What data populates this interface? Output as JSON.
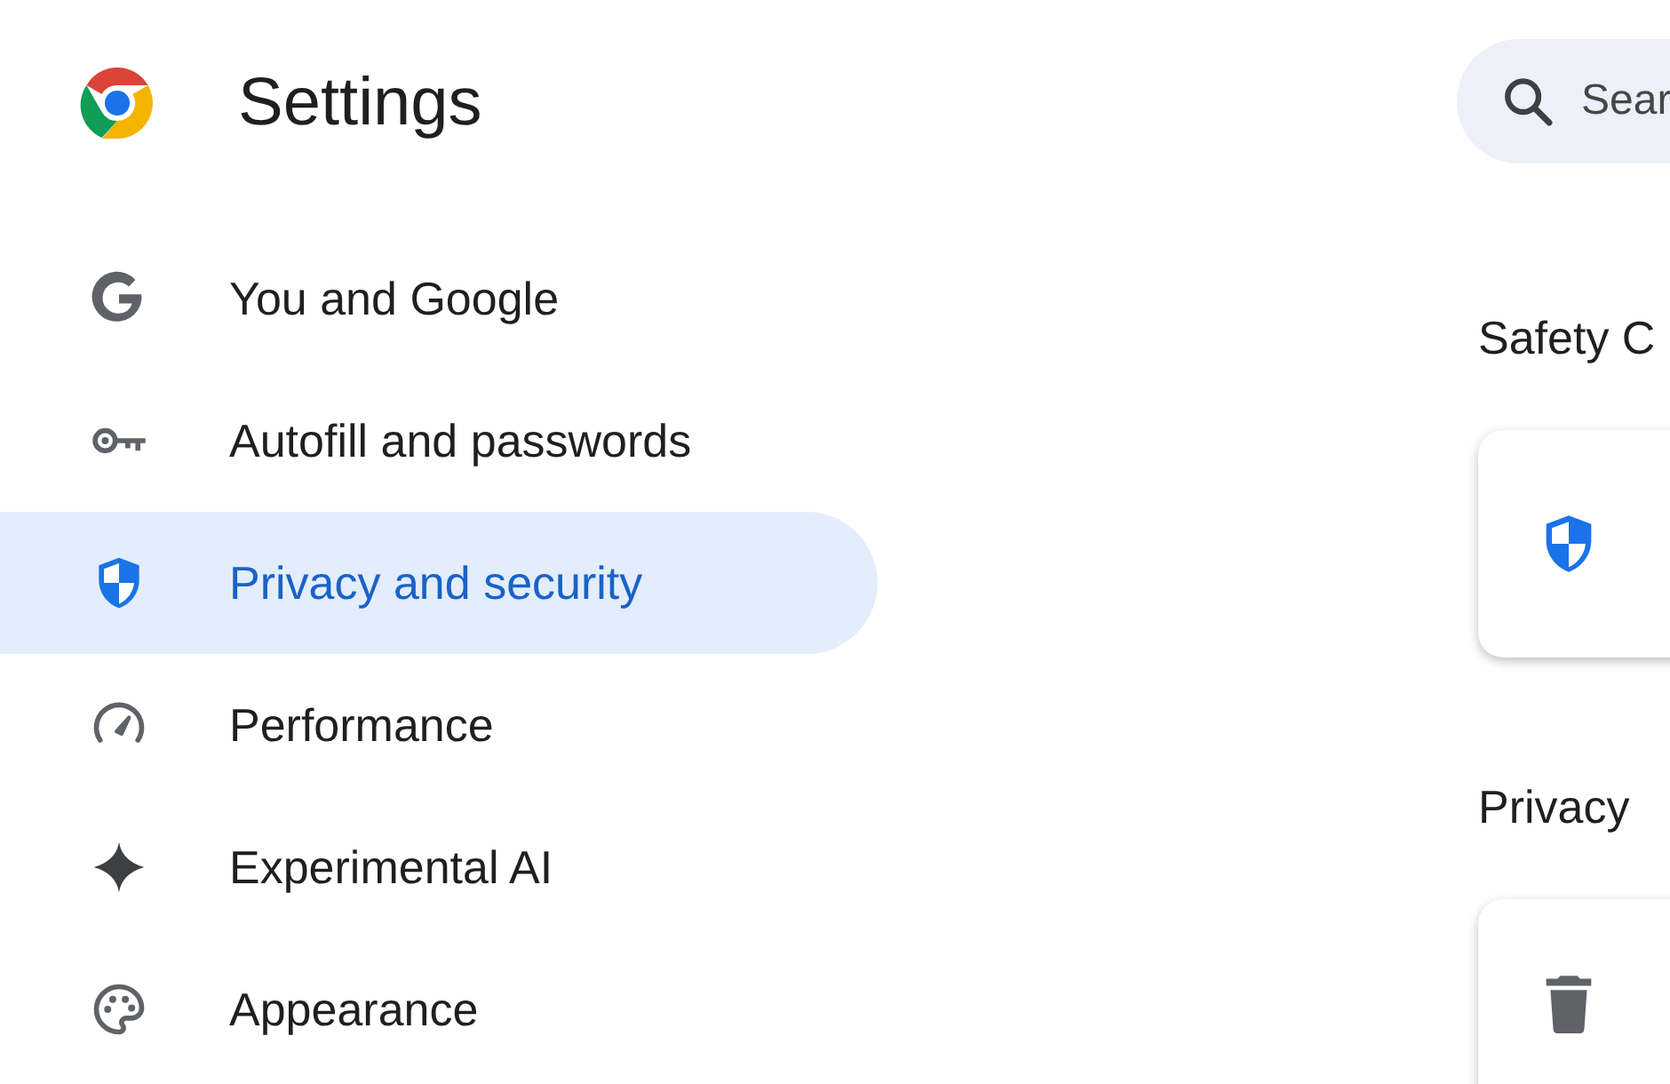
{
  "header": {
    "title": "Settings"
  },
  "search": {
    "placeholder": "Sear"
  },
  "sidebar": {
    "items": [
      {
        "label": "You and Google",
        "selected": false
      },
      {
        "label": "Autofill and passwords",
        "selected": false
      },
      {
        "label": "Privacy and security",
        "selected": true
      },
      {
        "label": "Performance",
        "selected": false
      },
      {
        "label": "Experimental AI",
        "selected": false
      },
      {
        "label": "Appearance",
        "selected": false
      }
    ]
  },
  "sections": [
    {
      "heading": "Safety C"
    },
    {
      "heading": "Privacy"
    }
  ]
}
